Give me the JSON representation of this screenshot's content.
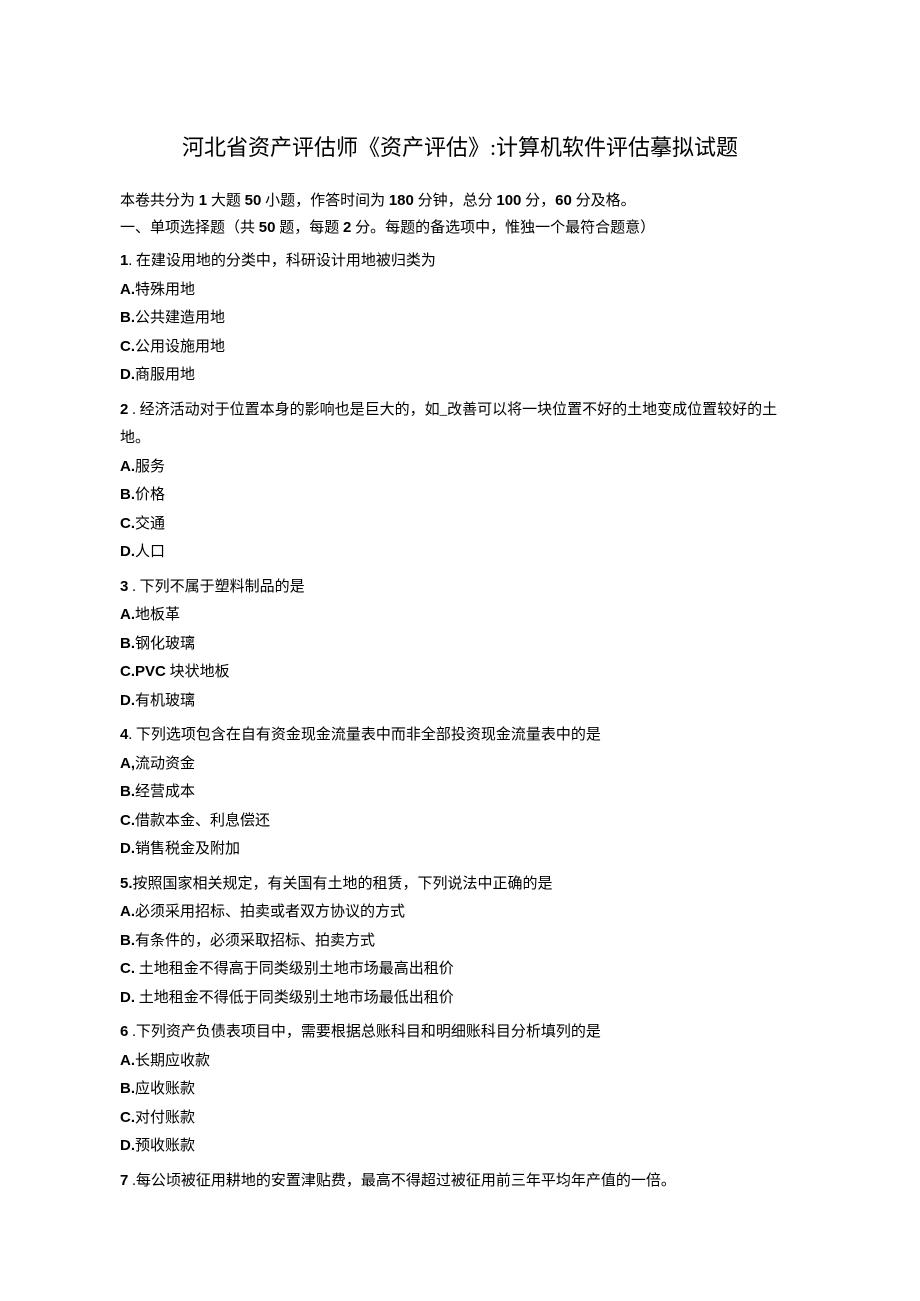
{
  "title": "河北省资产评估师《资产评估》:计算机软件评估摹拟试题",
  "intro_prefix": "本卷共分为 ",
  "intro_b1": "1",
  "intro_mid1": " 大题 ",
  "intro_b2": "50",
  "intro_mid2": " 小题，作答时间为 ",
  "intro_b3": "180",
  "intro_mid3": " 分钟，总分 ",
  "intro_b4": "100",
  "intro_mid4": " 分，",
  "intro_b5": "60",
  "intro_suffix": " 分及格。",
  "section_prefix": "一、单项选择题（共 ",
  "section_b1": "50",
  "section_mid": " 题，每题 ",
  "section_b2": "2",
  "section_suffix": " 分。每题的备选项中，惟独一个最符合题意）",
  "questions": [
    {
      "num": "1",
      "sep": ". ",
      "text": "在建设用地的分类中，科研设计用地被归类为",
      "opts": [
        {
          "letter": "A.",
          "text": "特殊用地"
        },
        {
          "letter": "B.",
          "text": "公共建造用地"
        },
        {
          "letter": "C.",
          "text": "公用设施用地"
        },
        {
          "letter": "D.",
          "text": "商服用地"
        }
      ]
    },
    {
      "num": "2",
      "sep": " . ",
      "text": "经济活动对于位置本身的影响也是巨大的，如_改善可以将一块位置不好的土地变成位置较好的土地。",
      "opts": [
        {
          "letter": "A.",
          "text": "服务"
        },
        {
          "letter": "B.",
          "text": "价格"
        },
        {
          "letter": "C.",
          "text": "交通"
        },
        {
          "letter": "D.",
          "text": "人口"
        }
      ]
    },
    {
      "num": "3",
      "sep": " . ",
      "text": "下列不属于塑料制品的是",
      "opts": [
        {
          "letter": "A.",
          "text": "地板革"
        },
        {
          "letter": "B.",
          "text": "钢化玻璃"
        },
        {
          "letter": "C.PVC",
          "text": " 块状地板"
        },
        {
          "letter": "D.",
          "text": "有机玻璃"
        }
      ]
    },
    {
      "num": "4",
      "sep": ". ",
      "text": "下列选项包含在自有资金现金流量表中而非全部投资现金流量表中的是",
      "opts": [
        {
          "letter": "A,",
          "text": "流动资金"
        },
        {
          "letter": "B.",
          "text": "经营成本"
        },
        {
          "letter": "C.",
          "text": "借款本金、利息偿还"
        },
        {
          "letter": "D.",
          "text": "销售税金及附加"
        }
      ]
    },
    {
      "num": "5.",
      "sep": "",
      "text": "按照国家相关规定，有关国有土地的租赁，下列说法中正确的是",
      "opts": [
        {
          "letter": "A.",
          "text": "必须采用招标、拍卖或者双方协议的方式"
        },
        {
          "letter": "B.",
          "text": "有条件的，必须采取招标、拍卖方式"
        },
        {
          "letter": "C.",
          "text": "   土地租金不得高于同类级别土地市场最高出租价"
        },
        {
          "letter": "D.",
          "text": "   土地租金不得低于同类级别土地市场最低出租价"
        }
      ]
    },
    {
      "num": "6",
      "sep": " .",
      "text": "下列资产负债表项目中，需要根据总账科目和明细账科目分析填列的是",
      "opts": [
        {
          "letter": "A.",
          "text": "长期应收款"
        },
        {
          "letter": "B.",
          "text": "应收账款"
        },
        {
          "letter": "C.",
          "text": "对付账款"
        },
        {
          "letter": "D.",
          "text": "预收账款"
        }
      ]
    },
    {
      "num": "7",
      "sep": " .",
      "text": "每公顷被征用耕地的安置津贴费，最高不得超过被征用前三年平均年产值的一倍。",
      "opts": []
    }
  ]
}
